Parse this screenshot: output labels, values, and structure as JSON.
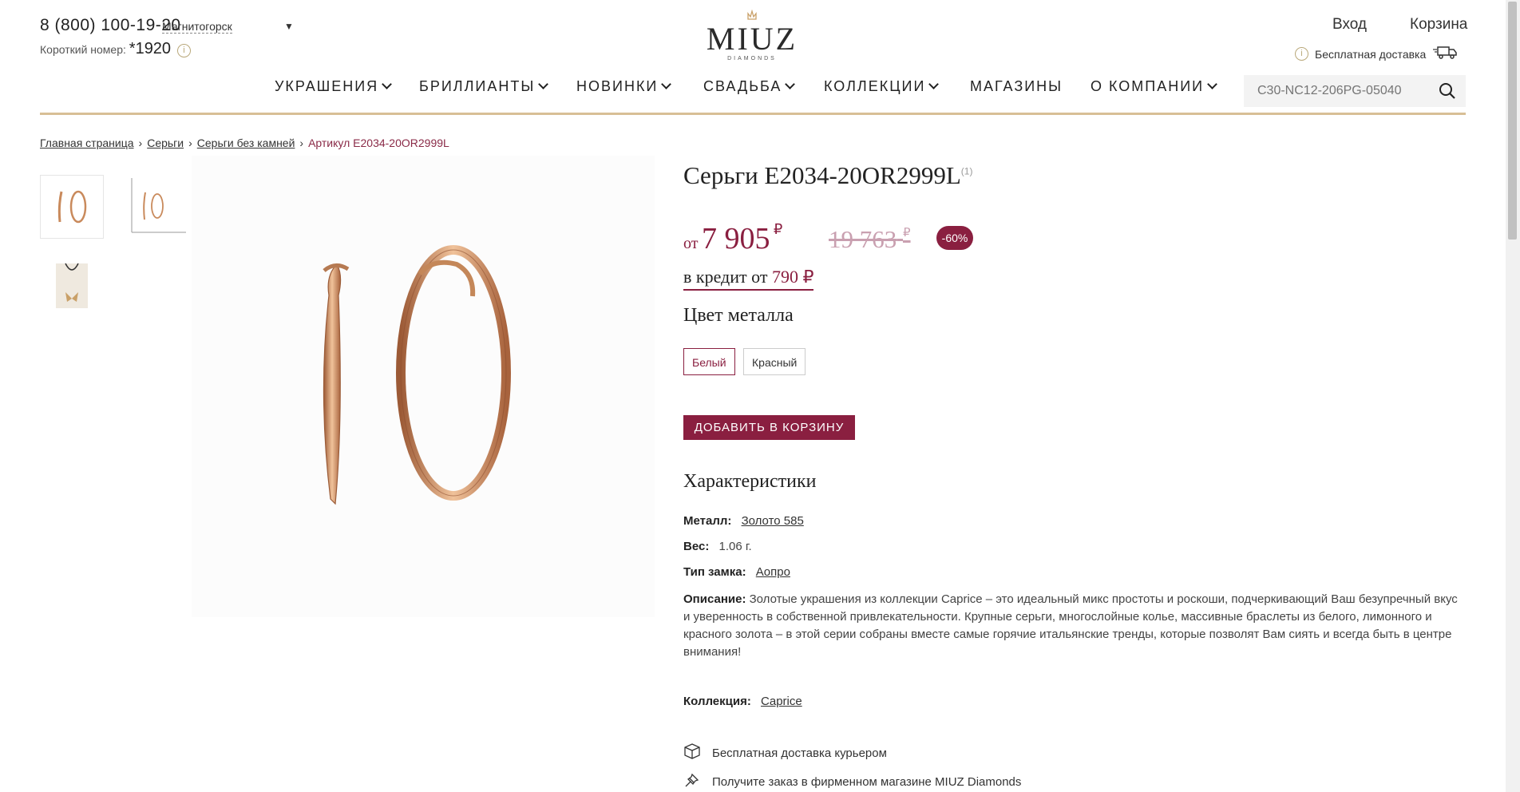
{
  "header": {
    "phone": "8 (800) 100-19-20",
    "city": "Магнитогорск",
    "short_label": "Короткий номер:",
    "short_number": "*1920",
    "logo_text": "MIUZ",
    "logo_sub": "DIAMONDS",
    "login": "Вход",
    "cart": "Корзина",
    "free_delivery": "Бесплатная доставка"
  },
  "nav": {
    "items": [
      {
        "label": "УКРАШЕНИЯ",
        "dropdown": true
      },
      {
        "label": "БРИЛЛИАНТЫ",
        "dropdown": true
      },
      {
        "label": "НОВИНКИ",
        "dropdown": true
      },
      {
        "label": "СВАДЬБА",
        "dropdown": true
      },
      {
        "label": "КОЛЛЕКЦИИ",
        "dropdown": true
      },
      {
        "label": "МАГАЗИНЫ",
        "dropdown": false
      },
      {
        "label": "О КОМПАНИИ",
        "dropdown": true
      }
    ],
    "search_placeholder": "C30-NC12-206PG-05040"
  },
  "breadcrumbs": [
    "Главная страница",
    "Серьги",
    "Серьги без камней",
    "Артикул E2034-20OR2999L"
  ],
  "product": {
    "title": "Серьги E2034-20OR2999L",
    "title_sup": "(1)",
    "price_prefix": "от",
    "price": "7 905",
    "currency": "₽",
    "old_price": "19 763",
    "discount": "-60%",
    "credit_prefix": "в кредит от",
    "credit_amount": "790 ₽",
    "color_heading": "Цвет металла",
    "colors": [
      "Белый",
      "Красный"
    ],
    "selected_color": "Белый",
    "add_to_cart": "ДОБАВИТЬ В КОРЗИНУ",
    "specs_heading": "Характеристики",
    "specs": {
      "metal_label": "Металл:",
      "metal_value": "Золото 585",
      "weight_label": "Вес:",
      "weight_value": "1.06 г.",
      "lock_label": "Тип замка:",
      "lock_value": "Аопро",
      "desc_label": "Описание:",
      "desc_value": "Золотые украшения из коллекции Caprice – это идеальный микс простоты и роскоши, подчеркивающий Ваш безупречный вкус и уверенность в собственной привлекательности. Крупные серьги, многослойные колье, массивные браслеты из белого, лимонного и красного золота – в этой серии собраны вместе самые горячие итальянские тренды, которые позволят Вам сиять и всегда быть в центре внимания!",
      "collection_label": "Коллекция:",
      "collection_value": "Caprice"
    },
    "perks": [
      "Бесплатная доставка курьером",
      "Получите заказ в фирменном магазине MIUZ Diamonds"
    ]
  },
  "colors": {
    "accent": "#8a1f40",
    "gold": "#d8bf96",
    "earring": "#c98a5c"
  }
}
